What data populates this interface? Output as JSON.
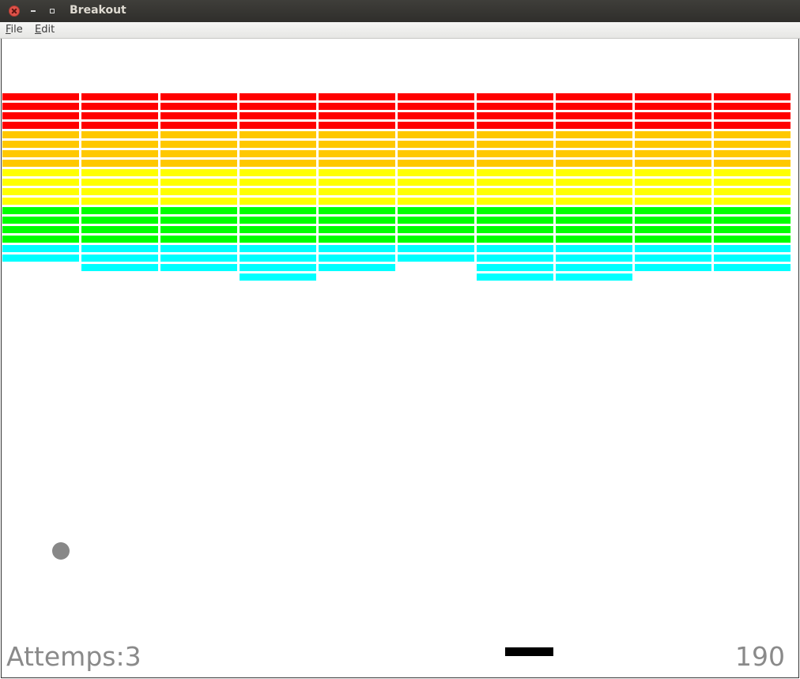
{
  "window": {
    "title": "Breakout"
  },
  "menu": {
    "file": "File",
    "edit": "Edit"
  },
  "hud": {
    "attempts": "Attemps:3",
    "score": "190"
  },
  "colors": {
    "red": "#ff0000",
    "orange": "#ffc800",
    "yellow": "#ffff00",
    "green": "#00ff00",
    "cyan": "#00ffff",
    "ball": "#888888",
    "paddle": "#000000",
    "hud_text": "#8a8a8a"
  },
  "bricks": {
    "columns": 10,
    "row_colors": [
      "red",
      "red",
      "red",
      "red",
      "orange",
      "orange",
      "orange",
      "orange",
      "yellow",
      "yellow",
      "yellow",
      "yellow",
      "green",
      "green",
      "green",
      "green",
      "cyan",
      "cyan",
      "cyan",
      "cyan"
    ],
    "present": [
      "1111111111",
      "1111111111",
      "1111111111",
      "1111111111",
      "1111111111",
      "1111111111",
      "1111111111",
      "1111111111",
      "1111111111",
      "1111111111",
      "1111111111",
      "1111111111",
      "1111111111",
      "1111111111",
      "1111111111",
      "1111111111",
      "1111111111",
      "1111111111",
      "0111101111",
      "0001001100"
    ]
  }
}
